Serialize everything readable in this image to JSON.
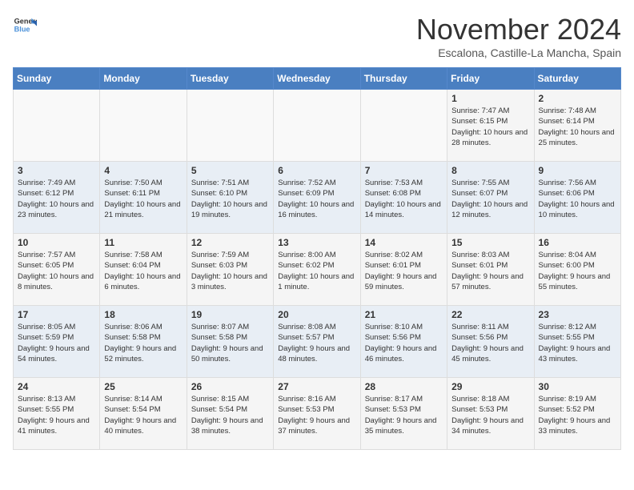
{
  "header": {
    "logo_line1": "General",
    "logo_line2": "Blue",
    "month": "November 2024",
    "location": "Escalona, Castille-La Mancha, Spain"
  },
  "days_of_week": [
    "Sunday",
    "Monday",
    "Tuesday",
    "Wednesday",
    "Thursday",
    "Friday",
    "Saturday"
  ],
  "weeks": [
    [
      {
        "day": "",
        "info": ""
      },
      {
        "day": "",
        "info": ""
      },
      {
        "day": "",
        "info": ""
      },
      {
        "day": "",
        "info": ""
      },
      {
        "day": "",
        "info": ""
      },
      {
        "day": "1",
        "info": "Sunrise: 7:47 AM\nSunset: 6:15 PM\nDaylight: 10 hours and 28 minutes."
      },
      {
        "day": "2",
        "info": "Sunrise: 7:48 AM\nSunset: 6:14 PM\nDaylight: 10 hours and 25 minutes."
      }
    ],
    [
      {
        "day": "3",
        "info": "Sunrise: 7:49 AM\nSunset: 6:12 PM\nDaylight: 10 hours and 23 minutes."
      },
      {
        "day": "4",
        "info": "Sunrise: 7:50 AM\nSunset: 6:11 PM\nDaylight: 10 hours and 21 minutes."
      },
      {
        "day": "5",
        "info": "Sunrise: 7:51 AM\nSunset: 6:10 PM\nDaylight: 10 hours and 19 minutes."
      },
      {
        "day": "6",
        "info": "Sunrise: 7:52 AM\nSunset: 6:09 PM\nDaylight: 10 hours and 16 minutes."
      },
      {
        "day": "7",
        "info": "Sunrise: 7:53 AM\nSunset: 6:08 PM\nDaylight: 10 hours and 14 minutes."
      },
      {
        "day": "8",
        "info": "Sunrise: 7:55 AM\nSunset: 6:07 PM\nDaylight: 10 hours and 12 minutes."
      },
      {
        "day": "9",
        "info": "Sunrise: 7:56 AM\nSunset: 6:06 PM\nDaylight: 10 hours and 10 minutes."
      }
    ],
    [
      {
        "day": "10",
        "info": "Sunrise: 7:57 AM\nSunset: 6:05 PM\nDaylight: 10 hours and 8 minutes."
      },
      {
        "day": "11",
        "info": "Sunrise: 7:58 AM\nSunset: 6:04 PM\nDaylight: 10 hours and 6 minutes."
      },
      {
        "day": "12",
        "info": "Sunrise: 7:59 AM\nSunset: 6:03 PM\nDaylight: 10 hours and 3 minutes."
      },
      {
        "day": "13",
        "info": "Sunrise: 8:00 AM\nSunset: 6:02 PM\nDaylight: 10 hours and 1 minute."
      },
      {
        "day": "14",
        "info": "Sunrise: 8:02 AM\nSunset: 6:01 PM\nDaylight: 9 hours and 59 minutes."
      },
      {
        "day": "15",
        "info": "Sunrise: 8:03 AM\nSunset: 6:01 PM\nDaylight: 9 hours and 57 minutes."
      },
      {
        "day": "16",
        "info": "Sunrise: 8:04 AM\nSunset: 6:00 PM\nDaylight: 9 hours and 55 minutes."
      }
    ],
    [
      {
        "day": "17",
        "info": "Sunrise: 8:05 AM\nSunset: 5:59 PM\nDaylight: 9 hours and 54 minutes."
      },
      {
        "day": "18",
        "info": "Sunrise: 8:06 AM\nSunset: 5:58 PM\nDaylight: 9 hours and 52 minutes."
      },
      {
        "day": "19",
        "info": "Sunrise: 8:07 AM\nSunset: 5:58 PM\nDaylight: 9 hours and 50 minutes."
      },
      {
        "day": "20",
        "info": "Sunrise: 8:08 AM\nSunset: 5:57 PM\nDaylight: 9 hours and 48 minutes."
      },
      {
        "day": "21",
        "info": "Sunrise: 8:10 AM\nSunset: 5:56 PM\nDaylight: 9 hours and 46 minutes."
      },
      {
        "day": "22",
        "info": "Sunrise: 8:11 AM\nSunset: 5:56 PM\nDaylight: 9 hours and 45 minutes."
      },
      {
        "day": "23",
        "info": "Sunrise: 8:12 AM\nSunset: 5:55 PM\nDaylight: 9 hours and 43 minutes."
      }
    ],
    [
      {
        "day": "24",
        "info": "Sunrise: 8:13 AM\nSunset: 5:55 PM\nDaylight: 9 hours and 41 minutes."
      },
      {
        "day": "25",
        "info": "Sunrise: 8:14 AM\nSunset: 5:54 PM\nDaylight: 9 hours and 40 minutes."
      },
      {
        "day": "26",
        "info": "Sunrise: 8:15 AM\nSunset: 5:54 PM\nDaylight: 9 hours and 38 minutes."
      },
      {
        "day": "27",
        "info": "Sunrise: 8:16 AM\nSunset: 5:53 PM\nDaylight: 9 hours and 37 minutes."
      },
      {
        "day": "28",
        "info": "Sunrise: 8:17 AM\nSunset: 5:53 PM\nDaylight: 9 hours and 35 minutes."
      },
      {
        "day": "29",
        "info": "Sunrise: 8:18 AM\nSunset: 5:53 PM\nDaylight: 9 hours and 34 minutes."
      },
      {
        "day": "30",
        "info": "Sunrise: 8:19 AM\nSunset: 5:52 PM\nDaylight: 9 hours and 33 minutes."
      }
    ]
  ]
}
